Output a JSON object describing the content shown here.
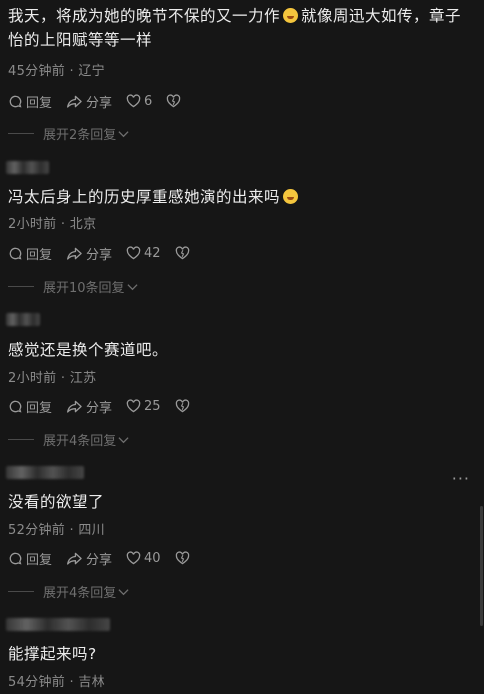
{
  "comments": [
    {
      "text_a": "我天，将成为她的晚节不保的又一力作",
      "text_b": "就像周迅大如传，章子怡的上阳赋等等一样",
      "emoji": "crying-laughing-emoji",
      "time": "45分钟前",
      "location": "辽宁",
      "reply_label": "回复",
      "share_label": "分享",
      "likes": "6",
      "expand_label": "展开2条回复"
    },
    {
      "text": "冯太后身上的历史厚重感她演的出来吗",
      "emoji": "grimace-emoji",
      "time": "2小时前",
      "location": "北京",
      "reply_label": "回复",
      "share_label": "分享",
      "likes": "42",
      "expand_label": "展开10条回复"
    },
    {
      "text": "感觉还是换个赛道吧。",
      "time": "2小时前",
      "location": "江苏",
      "reply_label": "回复",
      "share_label": "分享",
      "likes": "25",
      "expand_label": "展开4条回复"
    },
    {
      "text": "没看的欲望了",
      "time": "52分钟前",
      "location": "四川",
      "reply_label": "回复",
      "share_label": "分享",
      "likes": "40",
      "expand_label": "展开4条回复"
    },
    {
      "text": "能撑起来吗?",
      "time": "54分钟前",
      "location": "吉林"
    }
  ],
  "separator": " · ",
  "more_label": "···"
}
